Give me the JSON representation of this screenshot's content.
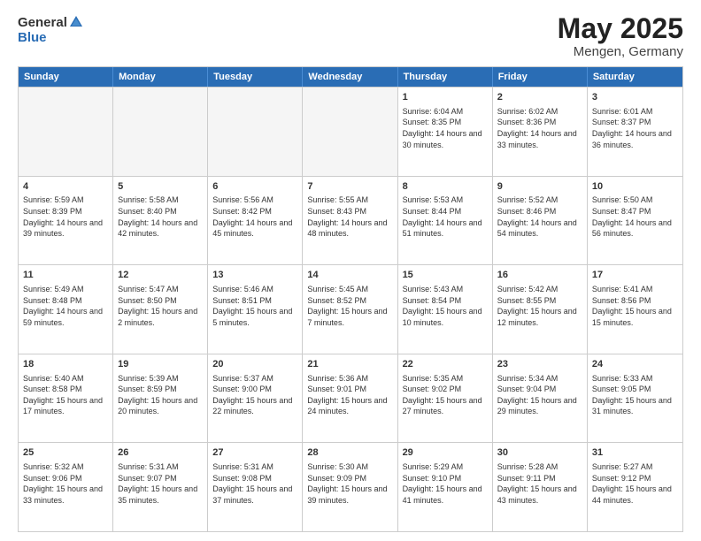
{
  "header": {
    "logo_general": "General",
    "logo_blue": "Blue",
    "title": "May 2025",
    "location": "Mengen, Germany"
  },
  "calendar": {
    "days": [
      "Sunday",
      "Monday",
      "Tuesday",
      "Wednesday",
      "Thursday",
      "Friday",
      "Saturday"
    ],
    "weeks": [
      [
        {
          "day": "",
          "empty": true
        },
        {
          "day": "",
          "empty": true
        },
        {
          "day": "",
          "empty": true
        },
        {
          "day": "",
          "empty": true
        },
        {
          "day": "1",
          "sunrise": "6:04 AM",
          "sunset": "8:35 PM",
          "daylight": "14 hours and 30 minutes."
        },
        {
          "day": "2",
          "sunrise": "6:02 AM",
          "sunset": "8:36 PM",
          "daylight": "14 hours and 33 minutes."
        },
        {
          "day": "3",
          "sunrise": "6:01 AM",
          "sunset": "8:37 PM",
          "daylight": "14 hours and 36 minutes."
        }
      ],
      [
        {
          "day": "4",
          "sunrise": "5:59 AM",
          "sunset": "8:39 PM",
          "daylight": "14 hours and 39 minutes."
        },
        {
          "day": "5",
          "sunrise": "5:58 AM",
          "sunset": "8:40 PM",
          "daylight": "14 hours and 42 minutes."
        },
        {
          "day": "6",
          "sunrise": "5:56 AM",
          "sunset": "8:42 PM",
          "daylight": "14 hours and 45 minutes."
        },
        {
          "day": "7",
          "sunrise": "5:55 AM",
          "sunset": "8:43 PM",
          "daylight": "14 hours and 48 minutes."
        },
        {
          "day": "8",
          "sunrise": "5:53 AM",
          "sunset": "8:44 PM",
          "daylight": "14 hours and 51 minutes."
        },
        {
          "day": "9",
          "sunrise": "5:52 AM",
          "sunset": "8:46 PM",
          "daylight": "14 hours and 54 minutes."
        },
        {
          "day": "10",
          "sunrise": "5:50 AM",
          "sunset": "8:47 PM",
          "daylight": "14 hours and 56 minutes."
        }
      ],
      [
        {
          "day": "11",
          "sunrise": "5:49 AM",
          "sunset": "8:48 PM",
          "daylight": "14 hours and 59 minutes."
        },
        {
          "day": "12",
          "sunrise": "5:47 AM",
          "sunset": "8:50 PM",
          "daylight": "15 hours and 2 minutes."
        },
        {
          "day": "13",
          "sunrise": "5:46 AM",
          "sunset": "8:51 PM",
          "daylight": "15 hours and 5 minutes."
        },
        {
          "day": "14",
          "sunrise": "5:45 AM",
          "sunset": "8:52 PM",
          "daylight": "15 hours and 7 minutes."
        },
        {
          "day": "15",
          "sunrise": "5:43 AM",
          "sunset": "8:54 PM",
          "daylight": "15 hours and 10 minutes."
        },
        {
          "day": "16",
          "sunrise": "5:42 AM",
          "sunset": "8:55 PM",
          "daylight": "15 hours and 12 minutes."
        },
        {
          "day": "17",
          "sunrise": "5:41 AM",
          "sunset": "8:56 PM",
          "daylight": "15 hours and 15 minutes."
        }
      ],
      [
        {
          "day": "18",
          "sunrise": "5:40 AM",
          "sunset": "8:58 PM",
          "daylight": "15 hours and 17 minutes."
        },
        {
          "day": "19",
          "sunrise": "5:39 AM",
          "sunset": "8:59 PM",
          "daylight": "15 hours and 20 minutes."
        },
        {
          "day": "20",
          "sunrise": "5:37 AM",
          "sunset": "9:00 PM",
          "daylight": "15 hours and 22 minutes."
        },
        {
          "day": "21",
          "sunrise": "5:36 AM",
          "sunset": "9:01 PM",
          "daylight": "15 hours and 24 minutes."
        },
        {
          "day": "22",
          "sunrise": "5:35 AM",
          "sunset": "9:02 PM",
          "daylight": "15 hours and 27 minutes."
        },
        {
          "day": "23",
          "sunrise": "5:34 AM",
          "sunset": "9:04 PM",
          "daylight": "15 hours and 29 minutes."
        },
        {
          "day": "24",
          "sunrise": "5:33 AM",
          "sunset": "9:05 PM",
          "daylight": "15 hours and 31 minutes."
        }
      ],
      [
        {
          "day": "25",
          "sunrise": "5:32 AM",
          "sunset": "9:06 PM",
          "daylight": "15 hours and 33 minutes."
        },
        {
          "day": "26",
          "sunrise": "5:31 AM",
          "sunset": "9:07 PM",
          "daylight": "15 hours and 35 minutes."
        },
        {
          "day": "27",
          "sunrise": "5:31 AM",
          "sunset": "9:08 PM",
          "daylight": "15 hours and 37 minutes."
        },
        {
          "day": "28",
          "sunrise": "5:30 AM",
          "sunset": "9:09 PM",
          "daylight": "15 hours and 39 minutes."
        },
        {
          "day": "29",
          "sunrise": "5:29 AM",
          "sunset": "9:10 PM",
          "daylight": "15 hours and 41 minutes."
        },
        {
          "day": "30",
          "sunrise": "5:28 AM",
          "sunset": "9:11 PM",
          "daylight": "15 hours and 43 minutes."
        },
        {
          "day": "31",
          "sunrise": "5:27 AM",
          "sunset": "9:12 PM",
          "daylight": "15 hours and 44 minutes."
        }
      ]
    ]
  }
}
